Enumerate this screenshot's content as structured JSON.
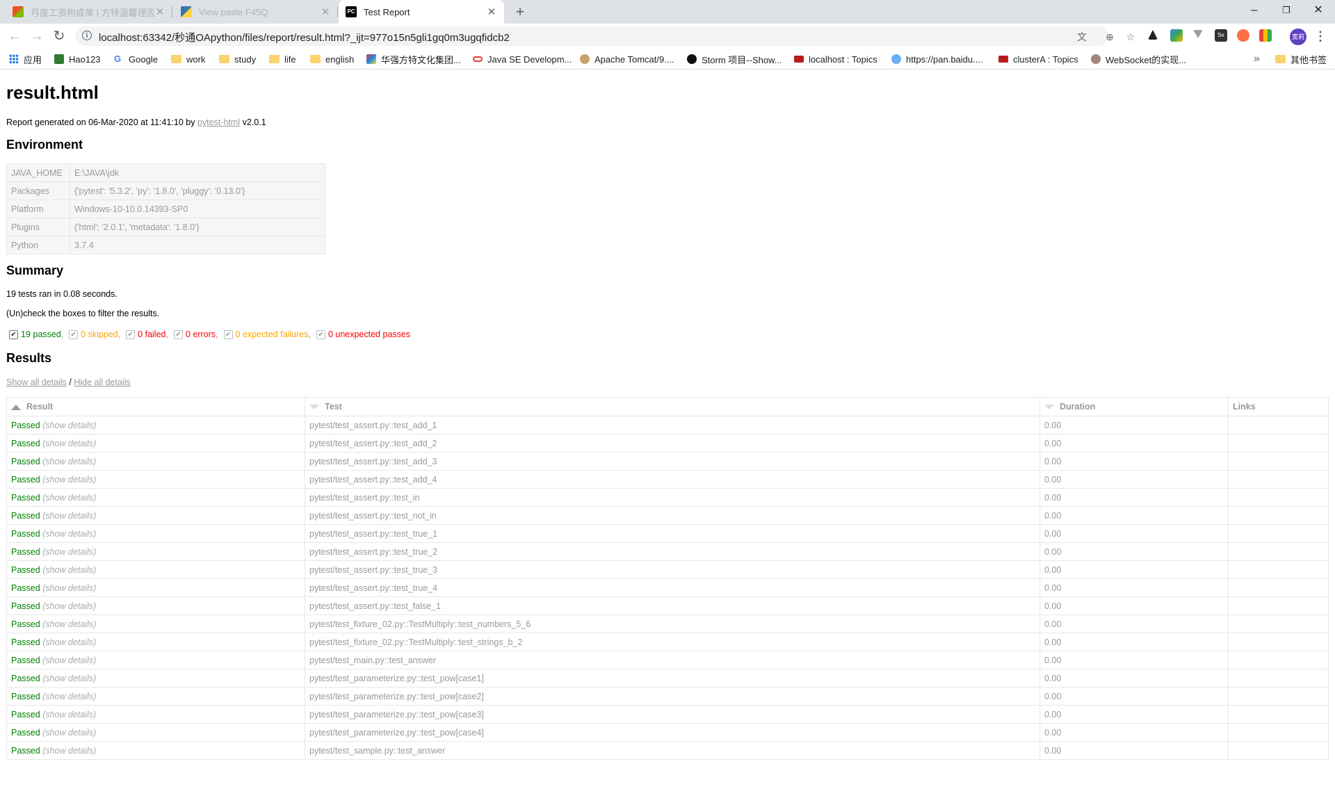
{
  "browser": {
    "tabs": [
      {
        "title": "月度工资构成单 | 方特温馨理否 ‹",
        "active": false
      },
      {
        "title": "View paste F45Q",
        "active": false
      },
      {
        "title": "Test Report",
        "active": true
      }
    ],
    "url": "localhost:63342/秒通OApython/files/report/result.html?_ijt=977o15n5gli1gq0m3ugqfidcb2",
    "avatar_text": "宽莉",
    "bookmarks": [
      "应用",
      "Hao123",
      "Google",
      "work",
      "study",
      "life",
      "english",
      "华强方特文化集团...",
      "Java SE Developm...",
      "Apache Tomcat/9....",
      "Storm 项目--Show...",
      "localhost : Topics",
      "https://pan.baidu....",
      "clusterA : Topics",
      "WebSocket的实现...",
      "其他书签"
    ],
    "overflow": "»"
  },
  "report": {
    "title": "result.html",
    "generated_prefix": "Report generated on 06-Mar-2020 at 11:41:10 by",
    "generated_link": "pytest-html",
    "generated_suffix": "v2.0.1",
    "env_heading": "Environment",
    "environment": [
      {
        "key": "JAVA_HOME",
        "value": "E:\\JAVA\\jdk"
      },
      {
        "key": "Packages",
        "value": "{'pytest': '5.3.2', 'py': '1.8.0', 'pluggy': '0.13.0'}"
      },
      {
        "key": "Platform",
        "value": "Windows-10-10.0.14393-SP0"
      },
      {
        "key": "Plugins",
        "value": "{'html': '2.0.1', 'metadata': '1.8.0'}"
      },
      {
        "key": "Python",
        "value": "3.7.4"
      }
    ],
    "summary_heading": "Summary",
    "summary_text": "19 tests ran in 0.08 seconds.",
    "filter_hint": "(Un)check the boxes to filter the results.",
    "filters": {
      "passed": "19 passed",
      "skipped": "0 skipped",
      "failed": "0 failed",
      "errors": "0 errors",
      "xfailed": "0 expected failures",
      "xpassed": "0 unexpected passes"
    },
    "results_heading": "Results",
    "show_all": "Show all details",
    "details_sep": "/",
    "hide_all": "Hide all details",
    "columns": [
      "Result",
      "Test",
      "Duration",
      "Links"
    ],
    "show_details": "(show details)",
    "results": [
      {
        "result": "Passed",
        "test": "pytest/test_assert.py::test_add_1",
        "duration": "0.00"
      },
      {
        "result": "Passed",
        "test": "pytest/test_assert.py::test_add_2",
        "duration": "0.00"
      },
      {
        "result": "Passed",
        "test": "pytest/test_assert.py::test_add_3",
        "duration": "0.00"
      },
      {
        "result": "Passed",
        "test": "pytest/test_assert.py::test_add_4",
        "duration": "0.00"
      },
      {
        "result": "Passed",
        "test": "pytest/test_assert.py::test_in",
        "duration": "0.00"
      },
      {
        "result": "Passed",
        "test": "pytest/test_assert.py::test_not_in",
        "duration": "0.00"
      },
      {
        "result": "Passed",
        "test": "pytest/test_assert.py::test_true_1",
        "duration": "0.00"
      },
      {
        "result": "Passed",
        "test": "pytest/test_assert.py::test_true_2",
        "duration": "0.00"
      },
      {
        "result": "Passed",
        "test": "pytest/test_assert.py::test_true_3",
        "duration": "0.00"
      },
      {
        "result": "Passed",
        "test": "pytest/test_assert.py::test_true_4",
        "duration": "0.00"
      },
      {
        "result": "Passed",
        "test": "pytest/test_assert.py::test_false_1",
        "duration": "0.00"
      },
      {
        "result": "Passed",
        "test": "pytest/test_fixture_02.py::TestMultiply::test_numbers_5_6",
        "duration": "0.00"
      },
      {
        "result": "Passed",
        "test": "pytest/test_fixture_02.py::TestMultiply::test_strings_b_2",
        "duration": "0.00"
      },
      {
        "result": "Passed",
        "test": "pytest/test_main.py::test_answer",
        "duration": "0.00"
      },
      {
        "result": "Passed",
        "test": "pytest/test_parameterize.py::test_pow[case1]",
        "duration": "0.00"
      },
      {
        "result": "Passed",
        "test": "pytest/test_parameterize.py::test_pow[case2]",
        "duration": "0.00"
      },
      {
        "result": "Passed",
        "test": "pytest/test_parameterize.py::test_pow[case3]",
        "duration": "0.00"
      },
      {
        "result": "Passed",
        "test": "pytest/test_parameterize.py::test_pow[case4]",
        "duration": "0.00"
      },
      {
        "result": "Passed",
        "test": "pytest/test_sample.py::test_answer",
        "duration": "0.00"
      }
    ]
  }
}
